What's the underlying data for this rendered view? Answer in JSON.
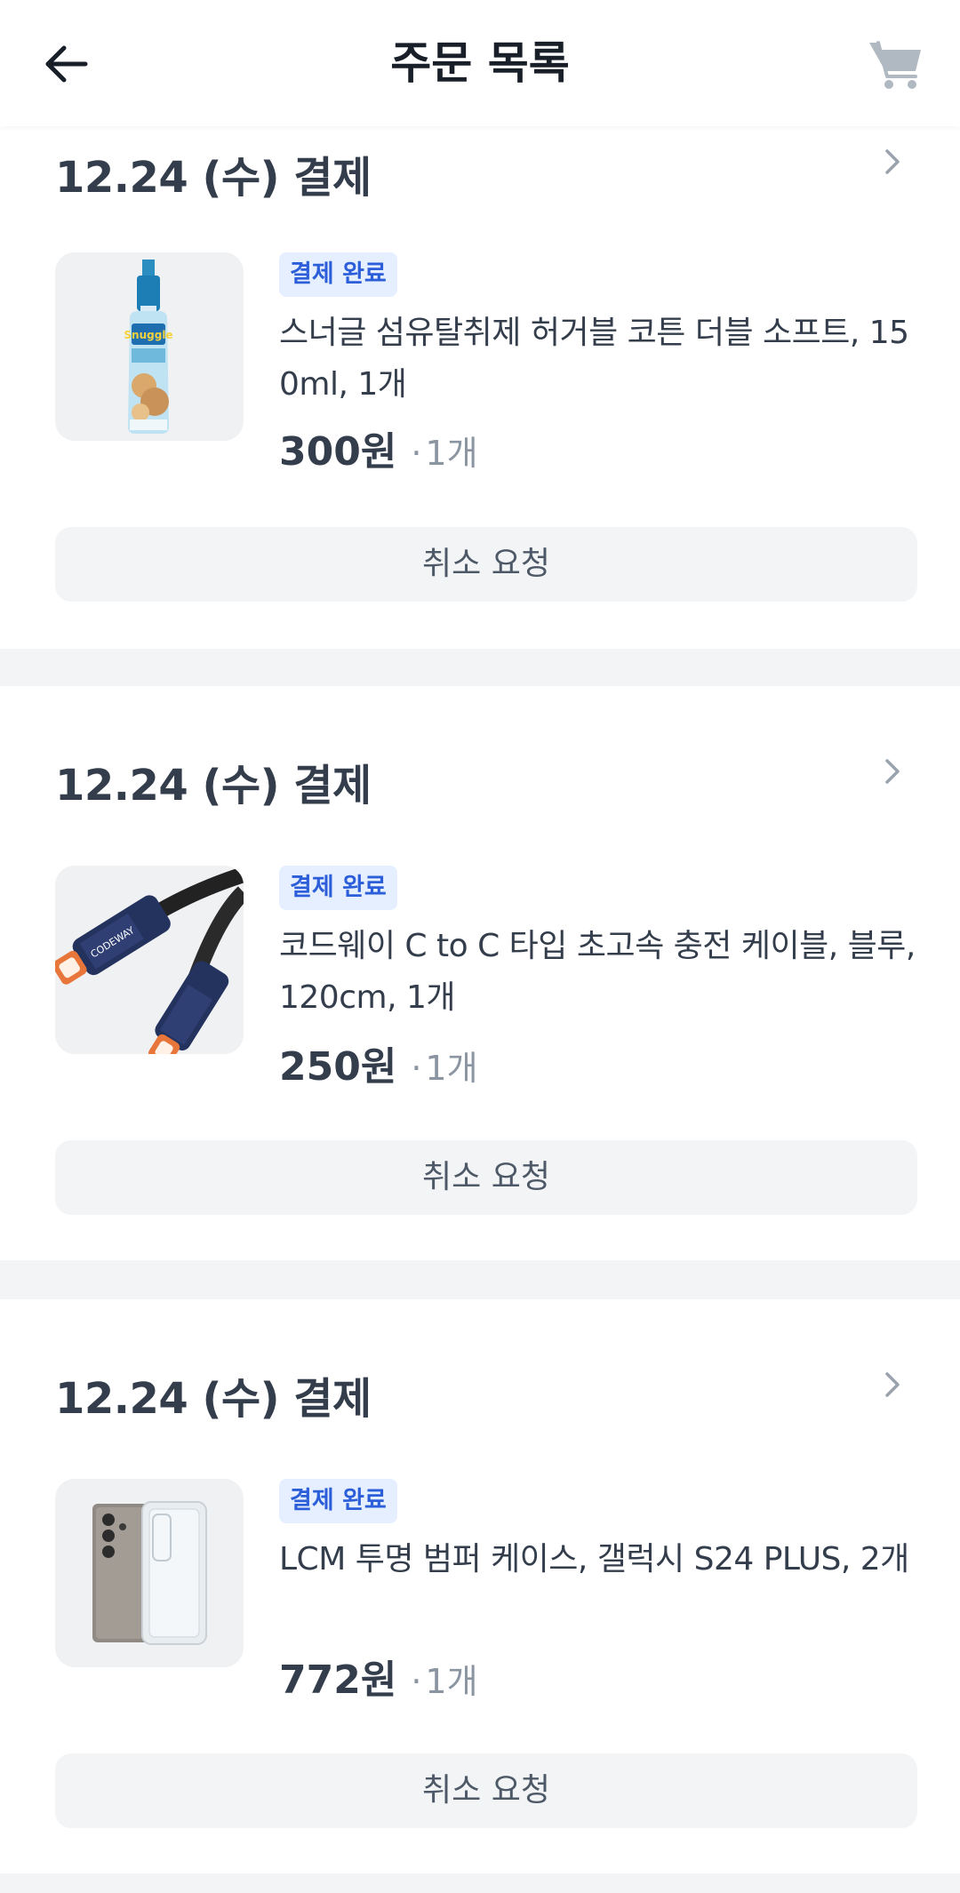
{
  "app_bar": {
    "title": "주문 목록",
    "back_icon": "arrow-left-icon",
    "cart_icon": "cart-icon"
  },
  "colors": {
    "badge_text": "#2b5ed8",
    "badge_bg": "#e5efff",
    "separator": "#f2f4f6"
  },
  "orders": [
    {
      "date": "12.24 (수) 결제",
      "status": "결제 완료",
      "product_name": "스너글 섬유탈취제 허거블 코튼 더블 소프트, 150ml, 1개",
      "price": "300원",
      "dot": "·",
      "quantity": "1개",
      "cancel_label": "취소 요청",
      "thumbnail": "fabric-spray-bottle-image"
    },
    {
      "date": "12.24 (수) 결제",
      "status": "결제 완료",
      "product_name": "코드웨이 C to C 타입 초고속 충전 케이블, 블루, 120cm, 1개",
      "price": "250원",
      "dot": "·",
      "quantity": "1개",
      "cancel_label": "취소 요청",
      "thumbnail": "usb-c-cable-image",
      "thumbnail_text": "CODEWAY"
    },
    {
      "date": "12.24 (수) 결제",
      "status": "결제 완료",
      "product_name": "LCM 투명 범퍼 케이스, 갤럭시 S24 PLUS, 2개",
      "price": "772원",
      "dot": "·",
      "quantity": "1개",
      "cancel_label": "취소 요청",
      "thumbnail": "phone-case-image"
    }
  ]
}
